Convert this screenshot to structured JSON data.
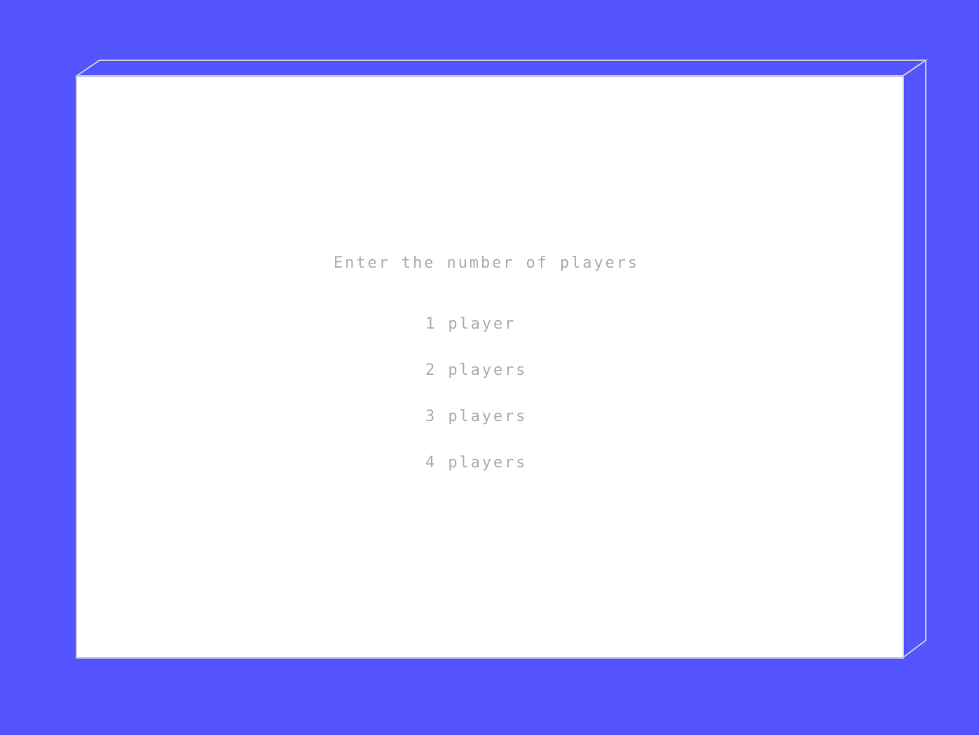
{
  "colors": {
    "background": "#5454ff",
    "screen": "#ffffff",
    "text": "#adadad",
    "frame_edge": "#c8c8d8"
  },
  "menu": {
    "prompt": "Enter the number of players",
    "options": [
      {
        "number": "1",
        "label": "player"
      },
      {
        "number": "2",
        "label": "players"
      },
      {
        "number": "3",
        "label": "players"
      },
      {
        "number": "4",
        "label": "players"
      }
    ]
  }
}
